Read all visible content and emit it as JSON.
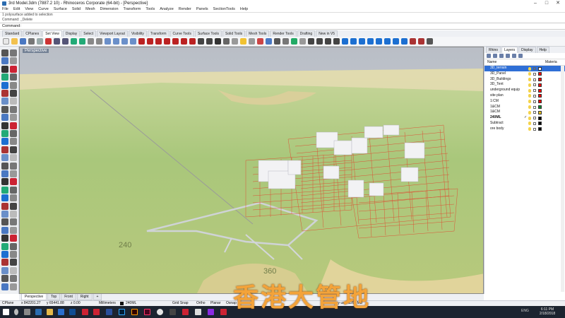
{
  "window": {
    "title": "3rd Model.3dm (7887.2 10) - Rhinoceros Corporate (64-bit) - [Perspective]"
  },
  "menu": [
    "File",
    "Edit",
    "View",
    "Curve",
    "Surface",
    "Solid",
    "Mesh",
    "Dimension",
    "Transform",
    "Tools",
    "Analyze",
    "Render",
    "Panels",
    "SectionTools",
    "Help"
  ],
  "command_history": [
    "1 polysurface added to selection",
    "Command: _Delete"
  ],
  "command_prompt": "Command:",
  "toolbar_tabs": [
    "Standard",
    "CPlanes",
    "Set View",
    "Display",
    "Select",
    "Viewport Layout",
    "Visibility",
    "Transform",
    "Curve Tools",
    "Surface Tools",
    "Solid Tools",
    "Mesh Tools",
    "Render Tools",
    "Drafting",
    "New in V5"
  ],
  "active_toolbar_tab": "Set View",
  "viewport": {
    "label": "Perspective",
    "contour_labels": [
      "240",
      "360"
    ]
  },
  "panel": {
    "tabs": [
      "Rhino",
      "Layers",
      "Display",
      "Help"
    ],
    "active_tab": "Layers",
    "header_name": "Name",
    "header_material": "Materia",
    "layers": [
      {
        "name": "3D_terrain",
        "color": "#ffffff",
        "selected": true
      },
      {
        "name": "3D_Panel",
        "color": "#ff0000",
        "selected": false
      },
      {
        "name": "3D_Buildings",
        "color": "#ff0000",
        "selected": false
      },
      {
        "name": "3D_Tent",
        "color": "#ff0000",
        "selected": false
      },
      {
        "name": "underground equip",
        "color": "#ff0000",
        "selected": false
      },
      {
        "name": "site plan",
        "color": "#ff0000",
        "selected": false
      },
      {
        "name": "1:CM",
        "color": "#ff0000",
        "selected": false
      },
      {
        "name": "1&CM",
        "color": "#0a8f2e",
        "selected": false
      },
      {
        "name": "1&CM",
        "color": "#e8c21f",
        "selected": false
      },
      {
        "name": "240ML",
        "color": "#000000",
        "selected": false,
        "current": true
      },
      {
        "name": "Subtract",
        "color": "#000000",
        "selected": false
      },
      {
        "name": "ore body",
        "color": "#000000",
        "selected": false
      }
    ]
  },
  "viewport_tabs": [
    "Perspective",
    "Top",
    "Front",
    "Right"
  ],
  "active_viewport_tab": "Perspective",
  "status": {
    "cplane": "CPlane",
    "x": "x 842201.27",
    "y": "y 65441.88",
    "z": "z 0.00",
    "units": "Millimeters",
    "layer": "240ML",
    "grid_snap": "Grid Snap",
    "ortho": "Ortho",
    "planar": "Planar",
    "osnap": "Osnap",
    "memory": "ory use: 1264 MB"
  },
  "taskbar": {
    "clock_time": "6:11 PM",
    "clock_date": "2/18/2018",
    "lang": "ENG"
  },
  "watermark": "香港大管地"
}
